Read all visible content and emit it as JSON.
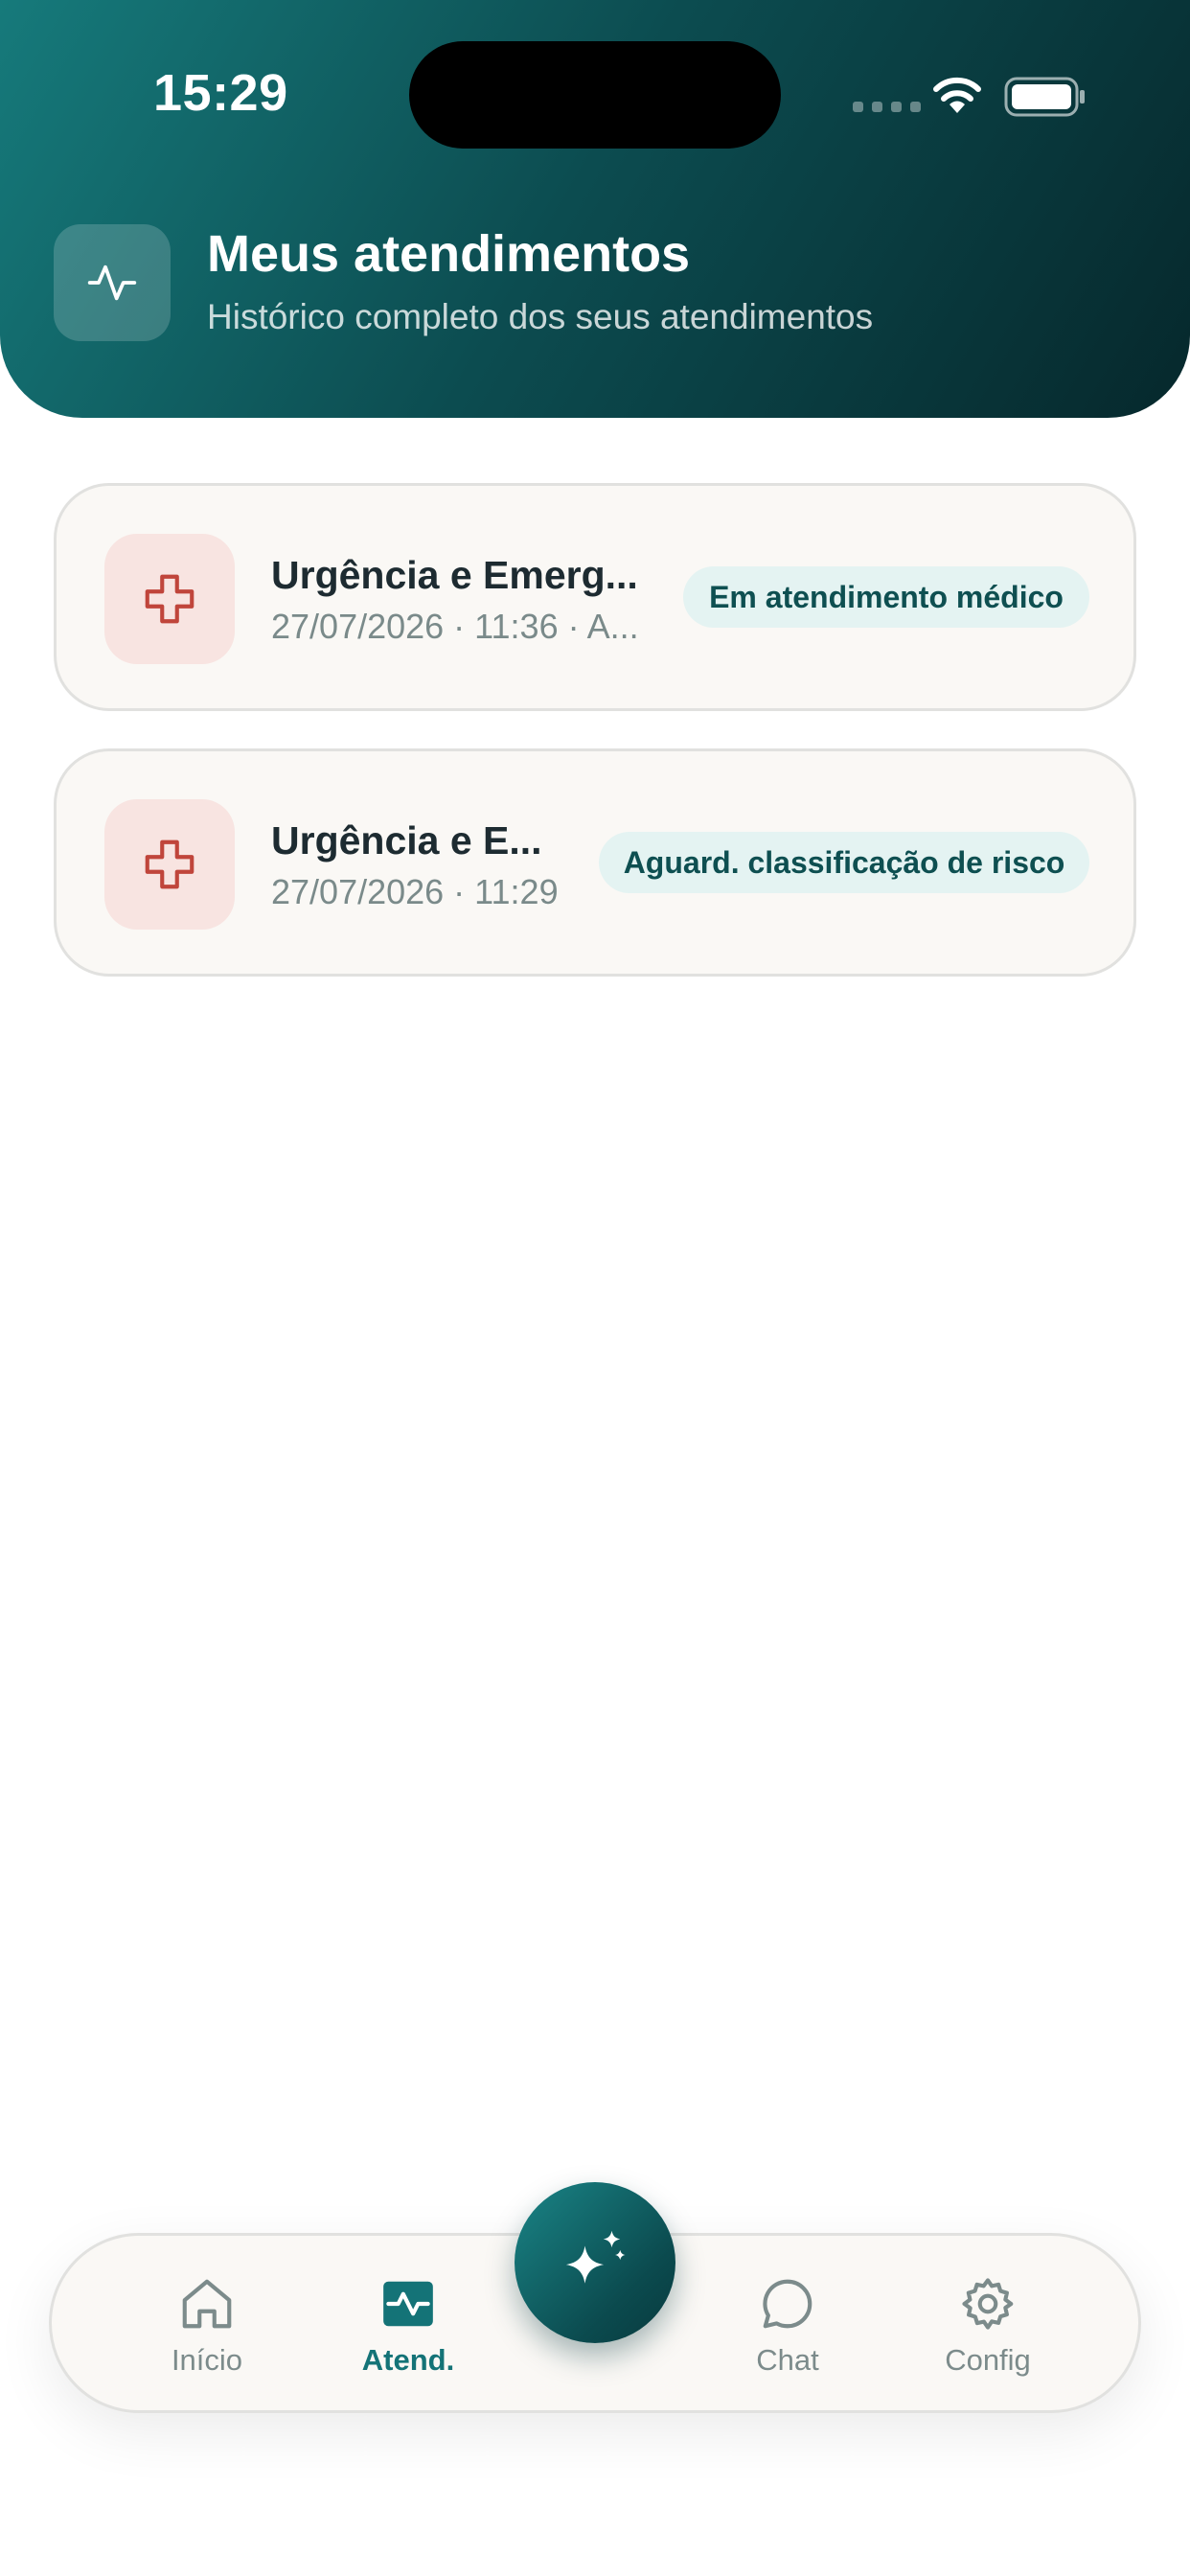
{
  "status_bar": {
    "time": "15:29"
  },
  "header": {
    "title": "Meus atendimentos",
    "subtitle": "Histórico completo dos seus atendimentos",
    "icon": "activity-icon"
  },
  "appointments": [
    {
      "title": "Urgência e Emerg...",
      "meta": "27/07/2026 · 11:36 · A...",
      "status": "Em atendimento médico",
      "icon": "medical-cross-icon"
    },
    {
      "title": "Urgência e E...",
      "meta": "27/07/2026 · 11:29",
      "status": "Aguard. classificação de risco",
      "icon": "medical-cross-icon"
    }
  ],
  "bottom_nav": {
    "items": [
      {
        "label": "Início",
        "icon": "home-icon",
        "active": false
      },
      {
        "label": "Atend.",
        "icon": "activity-icon",
        "active": true
      },
      {
        "label": "Chat",
        "icon": "chat-bubble-icon",
        "active": false
      },
      {
        "label": "Config",
        "icon": "gear-icon",
        "active": false
      }
    ],
    "fab_icon": "sparkles-icon"
  },
  "colors": {
    "primary": "#147377",
    "header_dark": "#06282c",
    "badge_bg": "#e4f3f2",
    "cross_red": "#c0453b",
    "cross_bg": "#f8e4e1"
  }
}
